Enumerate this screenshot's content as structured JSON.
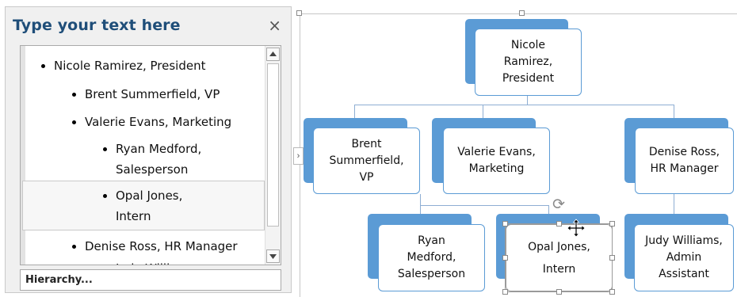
{
  "text_pane": {
    "title": "Type your text here",
    "close_label": "×",
    "items": [
      {
        "text": "Nicole Ramirez, President"
      },
      {
        "text": "Brent Summerfield, VP"
      },
      {
        "text": "Valerie Evans, Marketing"
      },
      {
        "line1": "Ryan Medford,",
        "line2": "Salesperson"
      },
      {
        "line1": "Opal Jones,",
        "line2": "Intern"
      },
      {
        "text": "Denise Ross, HR Manager"
      },
      {
        "text": "Judy Willi..."
      }
    ],
    "hierarchy_label": "Hierarchy...",
    "scroll_up_icon": "triangle-up",
    "scroll_down_icon": "triangle-down"
  },
  "canvas": {
    "expand_icon": "chevron-right",
    "nodes": {
      "nicole": {
        "line1": "Nicole",
        "line2": "Ramirez,",
        "line3": "President"
      },
      "brent": {
        "line1": "Brent",
        "line2": "Summerfield,",
        "line3": "VP"
      },
      "valerie": {
        "line1": "Valerie Evans,",
        "line2": "Marketing"
      },
      "denise": {
        "line1": "Denise Ross,",
        "line2": "HR Manager"
      },
      "ryan": {
        "line1": "Ryan",
        "line2": "Medford,",
        "line3": "Salesperson"
      },
      "opal": {
        "line1": "Opal Jones,",
        "line2": "Intern"
      },
      "judy": {
        "line1": "Judy Williams,",
        "line2": "Admin",
        "line3": "Assistant"
      }
    },
    "colors": {
      "accent": "#5b9bd5",
      "connector": "#8eaed3",
      "title": "#1f4e79"
    }
  }
}
